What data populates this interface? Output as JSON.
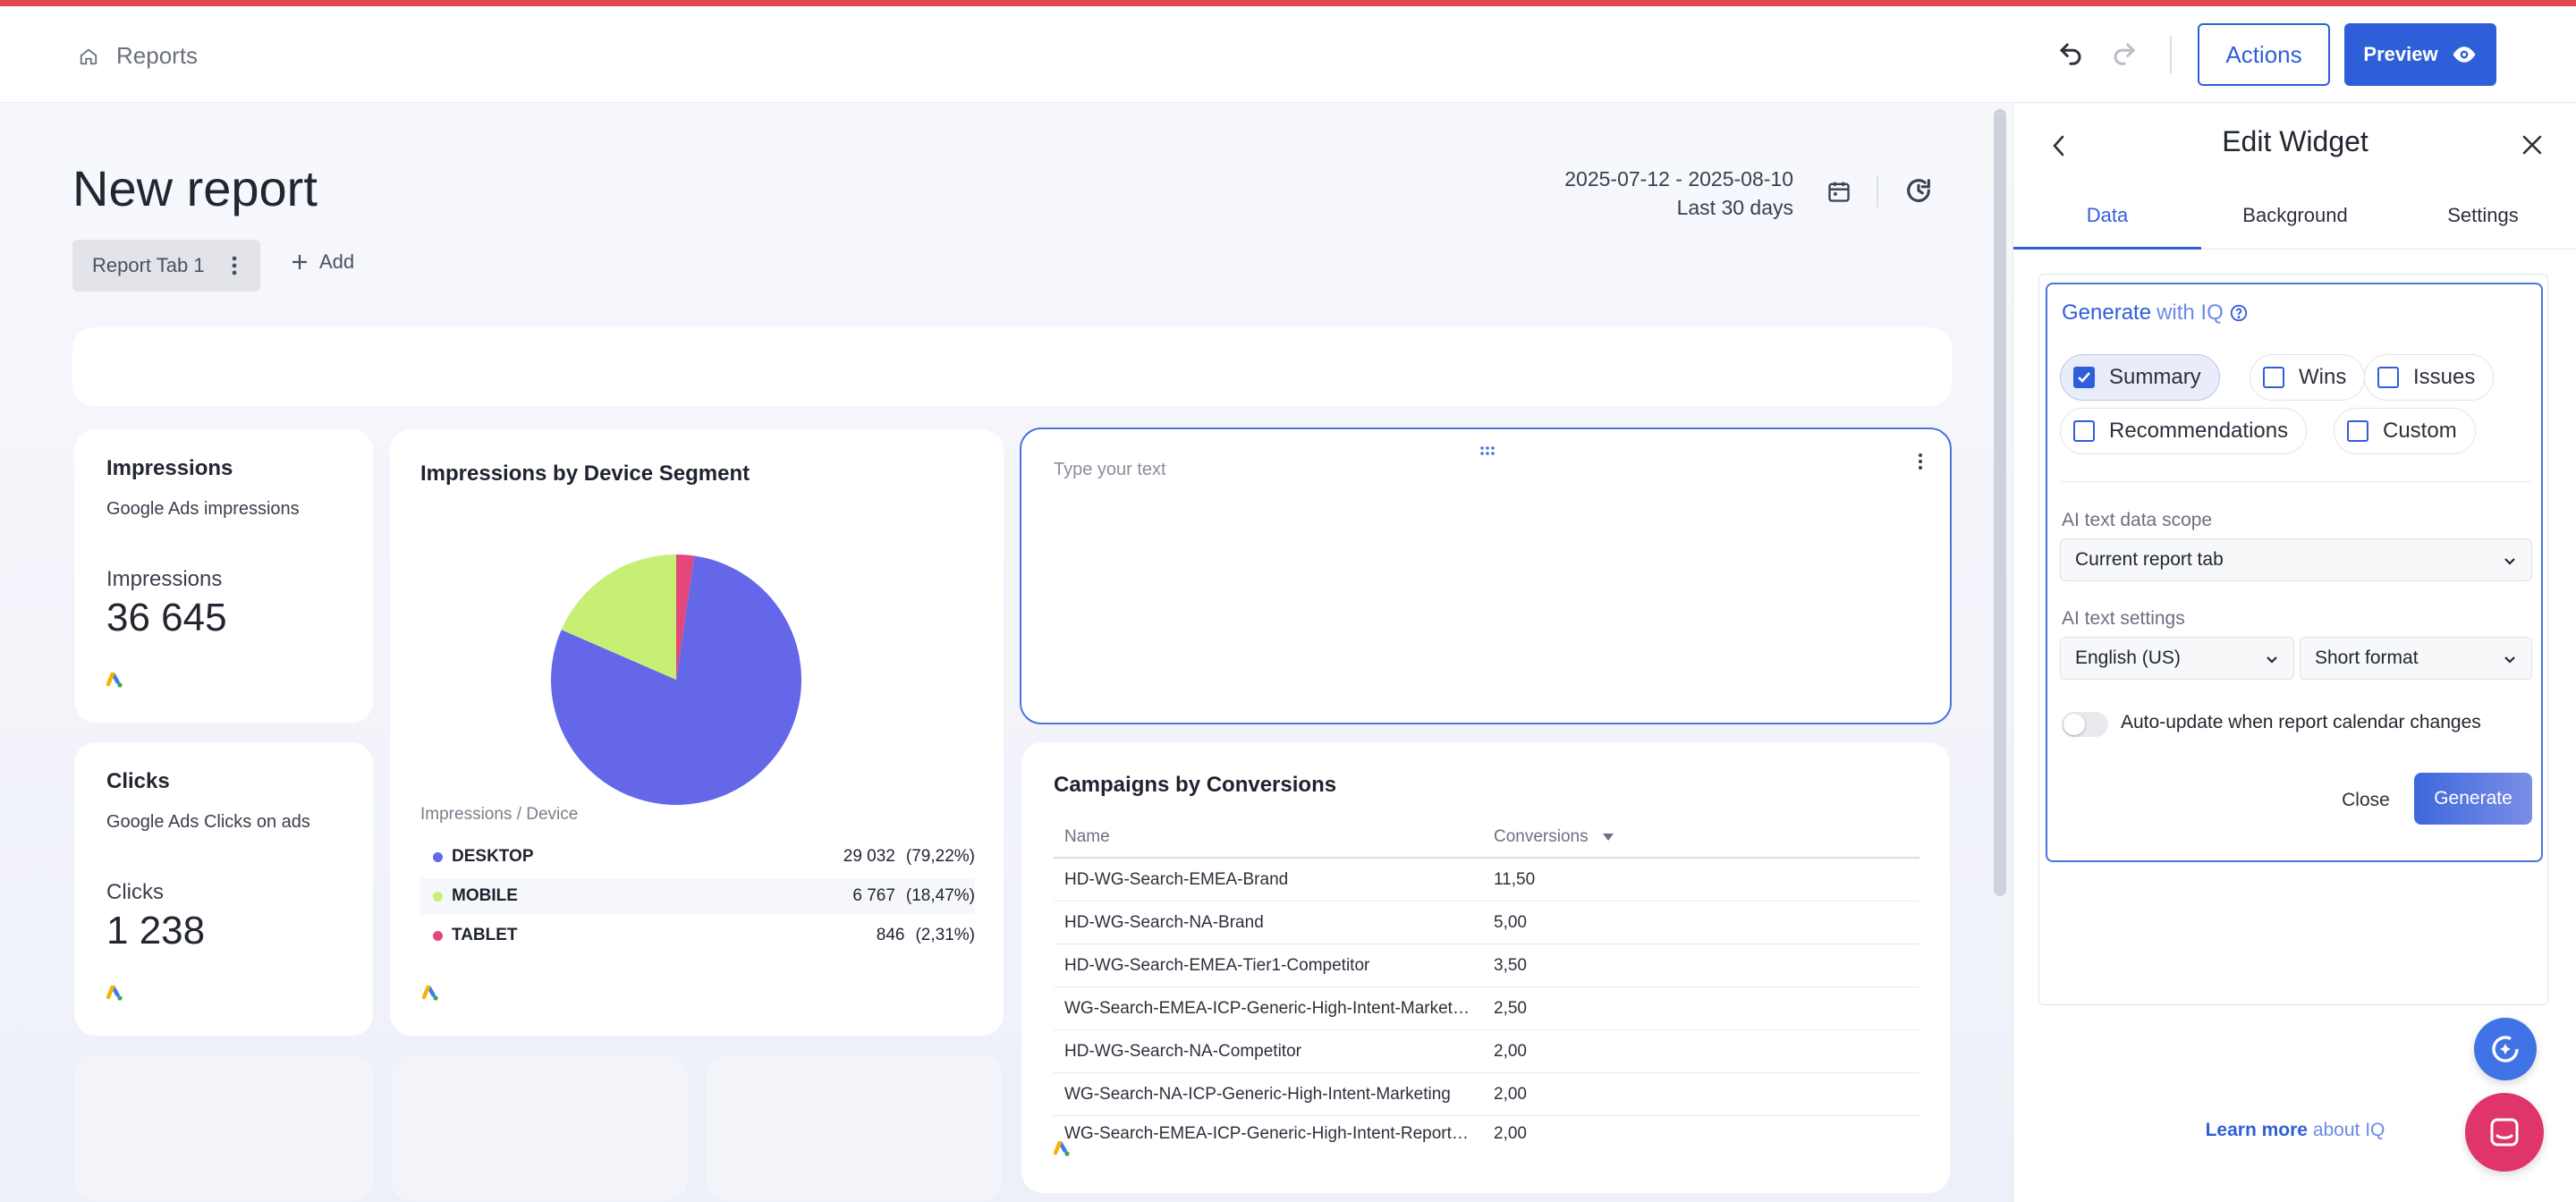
{
  "header": {
    "breadcrumb": "Reports",
    "actions_label": "Actions",
    "preview_label": "Preview"
  },
  "report": {
    "title": "New report",
    "date_range": "2025-07-12 - 2025-08-10",
    "date_preset": "Last 30 days",
    "tabs": [
      {
        "label": "Report Tab 1"
      }
    ],
    "add_tab_label": "Add"
  },
  "widgets": {
    "impressions": {
      "title": "Impressions",
      "subtitle": "Google Ads impressions",
      "metric_label": "Impressions",
      "value": "36 645"
    },
    "clicks": {
      "title": "Clicks",
      "subtitle": "Google Ads Clicks on ads",
      "metric_label": "Clicks",
      "value": "1 238"
    },
    "device_pie": {
      "title": "Impressions by Device Segment",
      "caption": "Impressions / Device",
      "rows": [
        {
          "name": "DESKTOP",
          "value": "29 032",
          "pct": "(79,22%)",
          "color": "#6467e8"
        },
        {
          "name": "MOBILE",
          "value": "6 767",
          "pct": "(18,47%)",
          "color": "#c7ef74"
        },
        {
          "name": "TABLET",
          "value": "846",
          "pct": "(2,31%)",
          "color": "#e2487c"
        }
      ]
    },
    "text_widget": {
      "placeholder": "Type your text"
    },
    "campaigns_table": {
      "title": "Campaigns by Conversions",
      "columns": [
        "Name",
        "Conversions"
      ],
      "rows": [
        {
          "name": "HD-WG-Search-EMEA-Brand",
          "conversions": "11,50"
        },
        {
          "name": "HD-WG-Search-NA-Brand",
          "conversions": "5,00"
        },
        {
          "name": "HD-WG-Search-EMEA-Tier1-Competitor",
          "conversions": "3,50"
        },
        {
          "name": "WG-Search-EMEA-ICP-Generic-High-Intent-Marketing",
          "conversions": "2,50"
        },
        {
          "name": "HD-WG-Search-NA-Competitor",
          "conversions": "2,00"
        },
        {
          "name": "WG-Search-NA-ICP-Generic-High-Intent-Marketing",
          "conversions": "2,00"
        },
        {
          "name": "WG-Search-EMEA-ICP-Generic-High-Intent-Reporting",
          "conversions": "2,00"
        }
      ]
    }
  },
  "chart_data": {
    "type": "pie",
    "title": "Impressions by Device Segment",
    "categories": [
      "DESKTOP",
      "MOBILE",
      "TABLET"
    ],
    "values": [
      29032,
      6767,
      846
    ],
    "percentages": [
      79.22,
      18.47,
      2.31
    ],
    "colors": [
      "#6467e8",
      "#c7ef74",
      "#e2487c"
    ]
  },
  "panel": {
    "title": "Edit Widget",
    "tabs": [
      "Data",
      "Background",
      "Settings"
    ],
    "active_tab": "Data",
    "generate_prefix": "Generate",
    "generate_suffix": "with IQ",
    "options": [
      {
        "label": "Summary",
        "checked": true
      },
      {
        "label": "Wins",
        "checked": false
      },
      {
        "label": "Issues",
        "checked": false
      },
      {
        "label": "Recommendations",
        "checked": false
      },
      {
        "label": "Custom",
        "checked": false
      }
    ],
    "scope_label": "AI text data scope",
    "scope_value": "Current report tab",
    "settings_label": "AI text settings",
    "language_value": "English (US)",
    "format_value": "Short format",
    "auto_update_label": "Auto-update when report calendar changes",
    "auto_update_on": false,
    "close_label": "Close",
    "generate_label": "Generate",
    "learn_prefix": "Learn more",
    "learn_suffix": "about IQ"
  },
  "colors": {
    "accent": "#2f5fd8",
    "top_bar": "#e2494b",
    "chat_button": "#e0356b"
  }
}
